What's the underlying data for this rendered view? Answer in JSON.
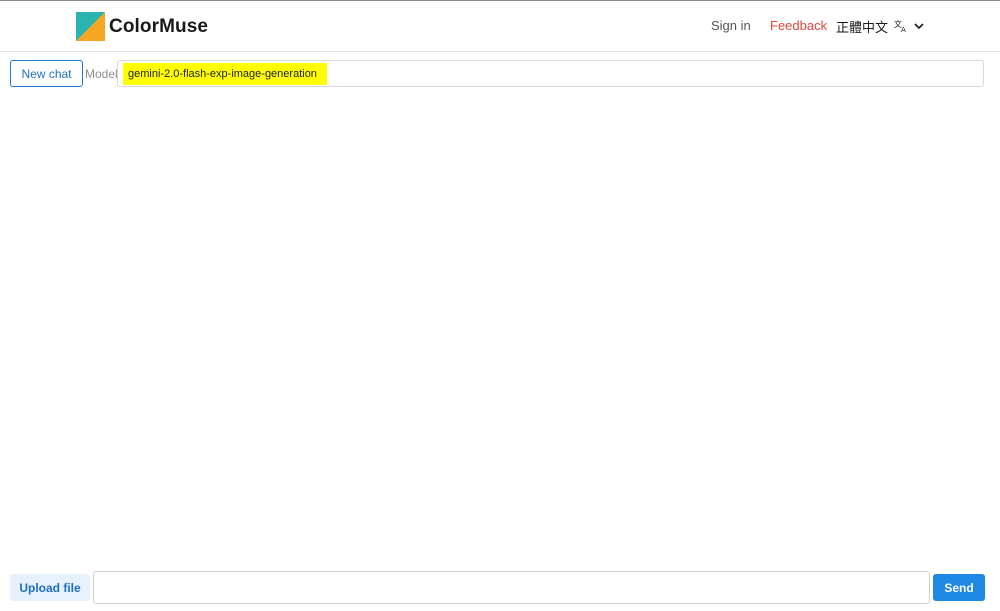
{
  "header": {
    "brand": "ColorMuse",
    "nav": {
      "sign_in": "Sign in",
      "feedback": "Feedback",
      "language": "正體中文"
    },
    "icons": {
      "logo": "colormuse-logo-icon",
      "language": "translate-icon",
      "dropdown": "chevron-down-icon"
    }
  },
  "toolbar": {
    "new_chat_label": "New chat",
    "model_label": "Model",
    "model_value": "gemini-2.0-flash-exp-image-generation"
  },
  "composer": {
    "upload_label": "Upload file",
    "message_value": "",
    "message_placeholder": "",
    "send_label": "Send"
  },
  "colors": {
    "accent": "#1e88e5",
    "feedback": "#e0473e",
    "highlight": "#ffff00",
    "logo_teal": "#2bb3b0",
    "logo_orange": "#f6a623"
  }
}
